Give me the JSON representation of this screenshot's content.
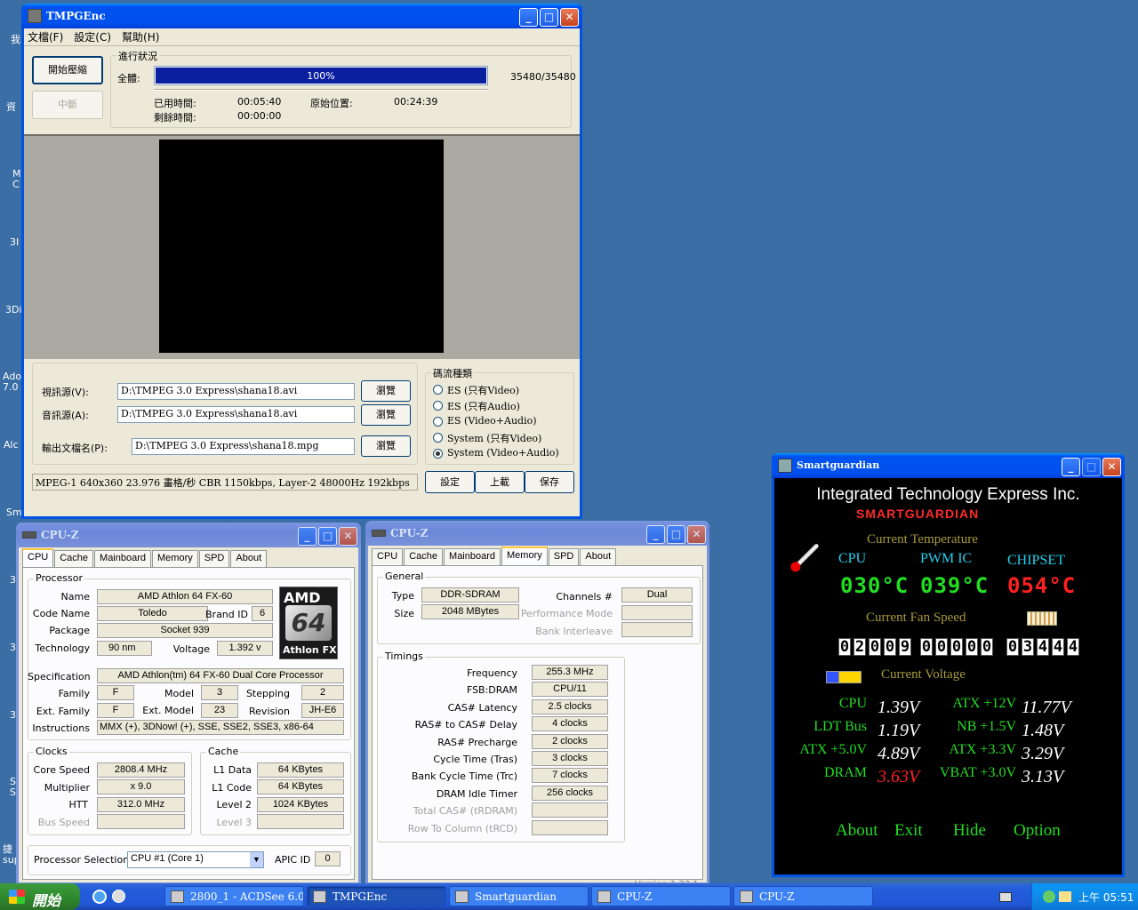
{
  "desktop": {
    "icon_labels": [
      "我",
      "資",
      "M\nC",
      "3I",
      "3Di",
      "Ado\n7.0",
      "Alc",
      "Sm",
      "3",
      "3",
      "3",
      "3",
      "S\nS",
      "捷\nsup"
    ]
  },
  "tmpgenc": {
    "title": "TMPGEnc",
    "menu": [
      "文檔(F)",
      "設定(C)",
      "幫助(H)"
    ],
    "start_btn": "開始壓縮",
    "stop_btn": "中斷",
    "progress_group": "進行狀況",
    "total_label": "全體:",
    "progress_pct": 100,
    "progress_text": "100%",
    "frames": "35480/35480",
    "elapsed_label": "已用時間:",
    "elapsed": "00:05:40",
    "remaining_label": "剩餘時間:",
    "remaining": "00:00:00",
    "source_pos_label": "原始位置:",
    "source_pos": "00:24:39",
    "video_label": "視訊源(V):",
    "video_path": "D:\\TMPEG 3.0 Express\\shana18.avi",
    "audio_label": "音訊源(A):",
    "audio_path": "D:\\TMPEG 3.0 Express\\shana18.avi",
    "output_label": "輸出文檔名(P):",
    "output_path": "D:\\TMPEG 3.0 Express\\shana18.mpg",
    "browse": "瀏覽",
    "stream_group": "碼流種類",
    "stream_types": [
      "ES (只有Video)",
      "ES (只有Audio)",
      "ES (Video+Audio)",
      "System (只有Video)",
      "System (Video+Audio)"
    ],
    "stream_selected": 4,
    "status": "MPEG-1 640x360 23.976 畫格/秒 CBR 1150kbps,  Layer-2 48000Hz 192kbps",
    "setup_btn": "設定",
    "load_btn": "上載",
    "save_btn": "保存"
  },
  "cpuz1": {
    "title": "CPU-Z",
    "tabs": [
      "CPU",
      "Cache",
      "Mainboard",
      "Memory",
      "SPD",
      "About"
    ],
    "processor_group": "Processor",
    "name_label": "Name",
    "name": "AMD Athlon 64 FX-60",
    "codename_label": "Code Name",
    "codename": "Toledo",
    "brandid_label": "Brand ID",
    "brandid": "6",
    "package_label": "Package",
    "package": "Socket 939",
    "tech_label": "Technology",
    "tech": "90 nm",
    "voltage_label": "Voltage",
    "voltage": "1.392 v",
    "spec_label": "Specification",
    "spec": "AMD Athlon(tm) 64 FX-60 Dual Core Processor",
    "family_label": "Family",
    "family": "F",
    "model_label": "Model",
    "model": "3",
    "stepping_label": "Stepping",
    "stepping": "2",
    "extfamily_label": "Ext. Family",
    "extfamily": "F",
    "extmodel_label": "Ext. Model",
    "extmodel": "23",
    "revision_label": "Revision",
    "revision": "JH-E6",
    "instr_label": "Instructions",
    "instr": "MMX (+), 3DNow! (+), SSE, SSE2, SSE3, x86-64",
    "clocks_group": "Clocks",
    "corespeed_label": "Core Speed",
    "corespeed": "2808.4 MHz",
    "multiplier_label": "Multiplier",
    "multiplier": "x 9.0",
    "htt_label": "HTT",
    "htt": "312.0 MHz",
    "busspeed_label": "Bus Speed",
    "cache_group": "Cache",
    "l1data_label": "L1 Data",
    "l1data": "64 KBytes",
    "l1code_label": "L1 Code",
    "l1code": "64 KBytes",
    "level2_label": "Level 2",
    "level2": "1024 KBytes",
    "level3_label": "Level 3",
    "procsel_label": "Processor Selection",
    "procsel": "CPU #1 (Core 1)",
    "apicid_label": "APIC ID",
    "apicid": "0",
    "logo_brand": "AMD",
    "logo_num": "64",
    "logo_line": "Athlon FX"
  },
  "cpuz2": {
    "title": "CPU-Z",
    "tabs": [
      "CPU",
      "Cache",
      "Mainboard",
      "Memory",
      "SPD",
      "About"
    ],
    "general_group": "General",
    "type_label": "Type",
    "type": "DDR-SDRAM",
    "size_label": "Size",
    "size": "2048 MBytes",
    "channels_label": "Channels #",
    "channels": "Dual",
    "perfmode_label": "Performance Mode",
    "bankint_label": "Bank Interleave",
    "timings_group": "Timings",
    "timings": [
      {
        "label": "Frequency",
        "value": "255.3 MHz"
      },
      {
        "label": "FSB:DRAM",
        "value": "CPU/11"
      },
      {
        "label": "CAS# Latency",
        "value": "2.5 clocks"
      },
      {
        "label": "RAS# to CAS# Delay",
        "value": "4 clocks"
      },
      {
        "label": "RAS# Precharge",
        "value": "2 clocks"
      },
      {
        "label": "Cycle Time (Tras)",
        "value": "3 clocks"
      },
      {
        "label": "Bank Cycle Time (Trc)",
        "value": "7 clocks"
      },
      {
        "label": "DRAM Idle Timer",
        "value": "256 clocks"
      },
      {
        "label": "Total CAS# (tRDRAM)",
        "value": ""
      },
      {
        "label": "Row To Column (tRCD)",
        "value": ""
      }
    ],
    "version": "Version 1.33.1"
  },
  "smartguardian": {
    "title": "Smartguardian",
    "company": "Integrated Technology Express Inc.",
    "product": "SMARTGUARDIAN",
    "temp_heading": "Current Temperature",
    "temps": [
      {
        "label": "CPU",
        "value": "030°C",
        "color": "#22dd22"
      },
      {
        "label": "PWM IC",
        "value": "039°C",
        "color": "#22dd22"
      },
      {
        "label": "CHIPSET",
        "value": "054°C",
        "color": "#ff2020"
      }
    ],
    "fan_heading": "Current Fan Speed",
    "fans": [
      "02009",
      "00000",
      "03444"
    ],
    "volt_heading": "Current Voltage",
    "volts": [
      {
        "label": "CPU",
        "value": "1.39V",
        "warn": false
      },
      {
        "label": "ATX +12V",
        "value": "11.77V",
        "warn": false
      },
      {
        "label": "LDT Bus",
        "value": "1.19V",
        "warn": false
      },
      {
        "label": "NB +1.5V",
        "value": "1.48V",
        "warn": false
      },
      {
        "label": "ATX +5.0V",
        "value": "4.89V",
        "warn": false
      },
      {
        "label": "ATX +3.3V",
        "value": "3.29V",
        "warn": false
      },
      {
        "label": "DRAM",
        "value": "3.63V",
        "warn": true
      },
      {
        "label": "VBAT +3.0V",
        "value": "3.13V",
        "warn": false
      }
    ],
    "buttons": [
      "About",
      "Exit",
      "Hide",
      "Option"
    ]
  },
  "taskbar": {
    "start": "開始",
    "tasks": [
      "2800_1 - ACDSee 6.0",
      "TMPGEnc",
      "Smartguardian",
      "CPU-Z",
      "CPU-Z"
    ],
    "active_task": 1,
    "clock": "上午 05:51"
  },
  "colors": {
    "sg_green": "#22dd22",
    "sg_red": "#ff2020",
    "sg_olive": "#a89a3a",
    "sg_cyan": "#22d0f0",
    "progress_blue": "#0a1fa0"
  }
}
